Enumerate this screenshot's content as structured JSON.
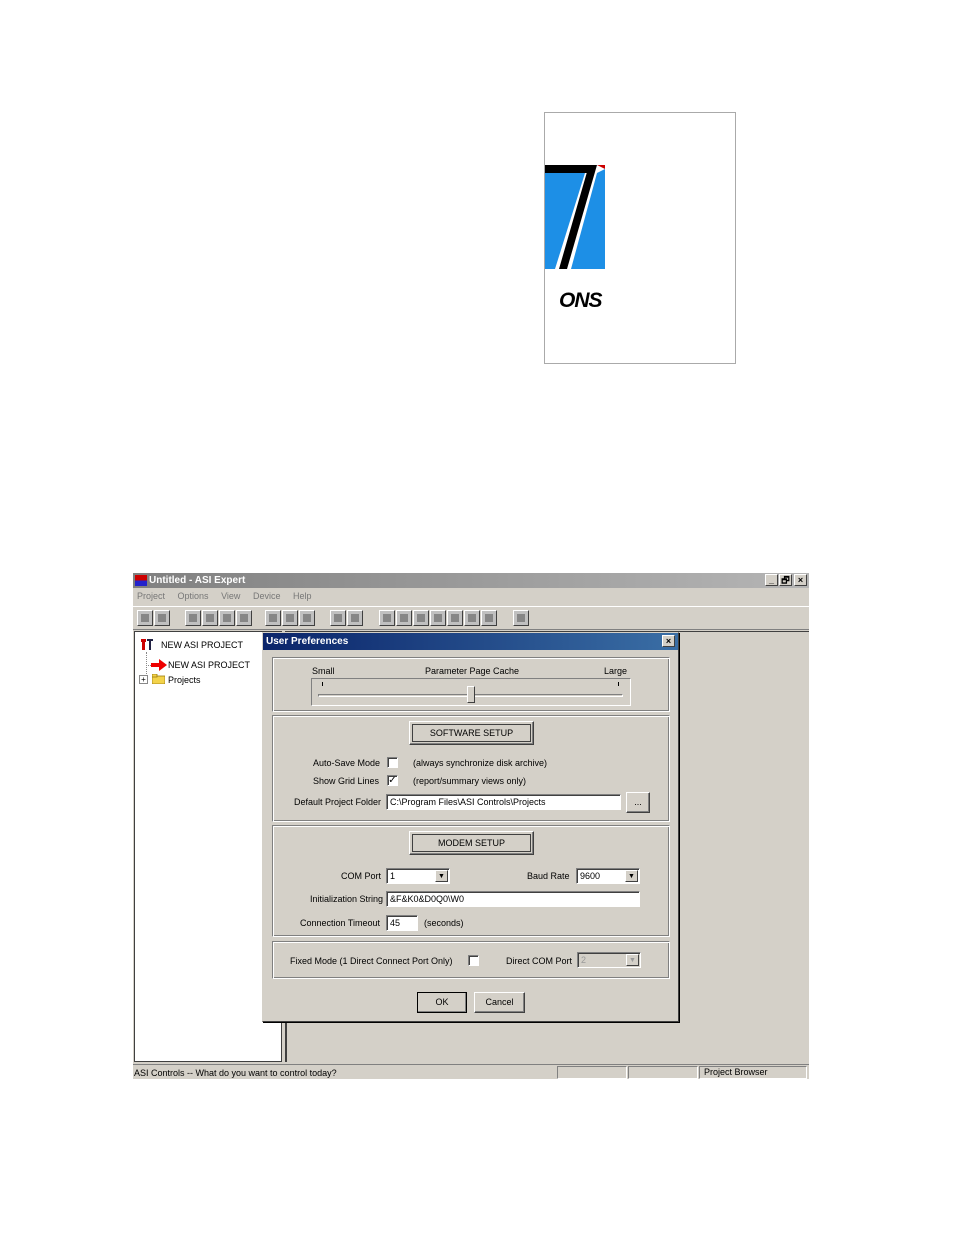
{
  "app": {
    "title": "Untitled - ASI Expert",
    "caption_buttons": {
      "minimize": "_",
      "restore": "🗗",
      "close": "×"
    },
    "menu": [
      "Project",
      "Options",
      "View",
      "Device",
      "Help"
    ]
  },
  "tree": {
    "root_label": "NEW ASI PROJECT",
    "child_label": "NEW ASI PROJECT",
    "folder_label": "Projects",
    "expander": "+"
  },
  "logo": {
    "text_fragment": "ONS",
    "reg": "R"
  },
  "statusbar": {
    "message": "ASI Controls -- What do you want to control today?",
    "pane3": "Project Browser"
  },
  "dialog": {
    "title": "User Preferences",
    "close": "×",
    "cache": {
      "small": "Small",
      "label": "Parameter Page Cache",
      "large": "Large",
      "level": 0.5
    },
    "software": {
      "button": "SOFTWARE SETUP",
      "autosave_label": "Auto-Save Mode",
      "autosave_checked": false,
      "autosave_note": "(always synchronize disk archive)",
      "grid_label": "Show Grid Lines",
      "grid_checked": true,
      "grid_note": "(report/summary views only)",
      "folder_label": "Default Project Folder",
      "folder_value": "C:\\Program Files\\ASI Controls\\Projects",
      "browse": "..."
    },
    "modem": {
      "button": "MODEM SETUP",
      "com_label": "COM Port",
      "com_value": "1",
      "baud_label": "Baud Rate",
      "baud_value": "9600",
      "init_label": "Initialization String",
      "init_value": "&F&K0&D0Q0\\W0",
      "timeout_label": "Connection Timeout",
      "timeout_value": "45",
      "timeout_unit": "(seconds)"
    },
    "fixed": {
      "label": "Fixed Mode (1 Direct Connect Port Only)",
      "checked": false,
      "direct_label": "Direct COM Port",
      "direct_value": "2"
    },
    "ok": "OK",
    "cancel": "Cancel"
  }
}
